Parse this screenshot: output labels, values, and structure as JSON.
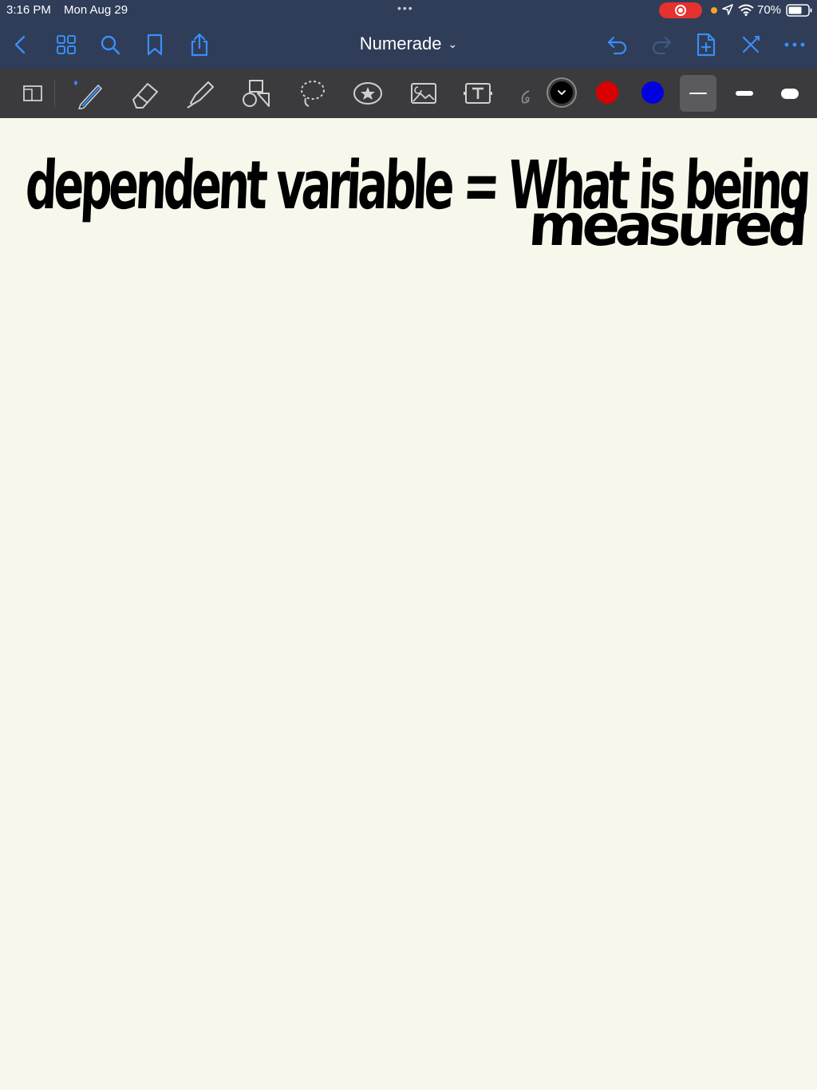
{
  "status": {
    "time": "3:16 PM",
    "date": "Mon Aug 29",
    "dots": "•••",
    "battery": "70%"
  },
  "nav": {
    "title": "Numerade",
    "icons": [
      "chevron-left-icon",
      "grid-icon",
      "search-icon",
      "bookmark-icon",
      "share-icon",
      "undo-icon",
      "redo-icon",
      "add-page-icon",
      "close-toolbar-icon",
      "more-icon"
    ]
  },
  "toolbar": {
    "tools": [
      "page-read-mode",
      "pen",
      "eraser",
      "highlighter",
      "shapes",
      "lasso",
      "elements",
      "image",
      "text",
      "laser-pointer"
    ],
    "colors": [
      "#000000",
      "#d80000",
      "#0000e0"
    ],
    "selected_color": "#000000",
    "sizes": [
      "thin",
      "medium",
      "thick"
    ],
    "selected_size": "thin",
    "accent": "#3a8ef6"
  },
  "canvas": {
    "handwriting_line1": "dependent variable = What is being",
    "handwriting_line2": "measured"
  }
}
